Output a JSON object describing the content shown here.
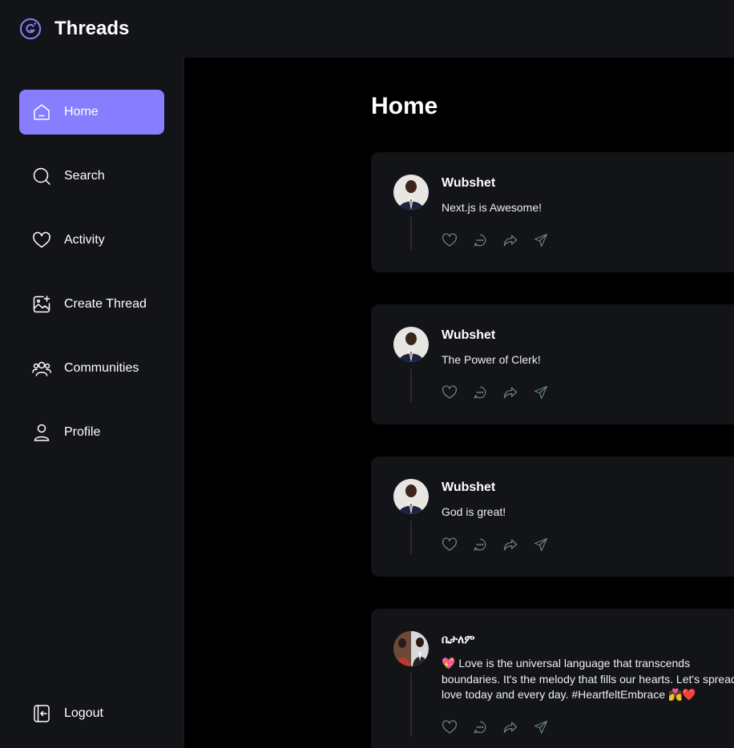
{
  "app": {
    "brand": "Threads"
  },
  "sidebar": {
    "items": [
      {
        "label": "Home",
        "icon": "home-icon",
        "active": true
      },
      {
        "label": "Search",
        "icon": "search-icon"
      },
      {
        "label": "Activity",
        "icon": "heart-icon"
      },
      {
        "label": "Create Thread",
        "icon": "image-plus-icon"
      },
      {
        "label": "Communities",
        "icon": "users-icon"
      },
      {
        "label": "Profile",
        "icon": "user-icon"
      }
    ],
    "logout_label": "Logout"
  },
  "main": {
    "title": "Home",
    "threads": [
      {
        "author": "Wubshet",
        "text": "Next.js is Awesome!"
      },
      {
        "author": "Wubshet",
        "text": "The Power of Clerk!"
      },
      {
        "author": "Wubshet",
        "text": "God is great!"
      },
      {
        "author": "ቤታለም",
        "text": "💖 Love is the universal language that transcends boundaries. It's the melody that fills our hearts. Let's spread love today and every day. #HeartfeltEmbrace 💏❤️"
      }
    ]
  },
  "colors": {
    "accent": "#877eff",
    "panel": "#121417",
    "background": "#000000"
  }
}
